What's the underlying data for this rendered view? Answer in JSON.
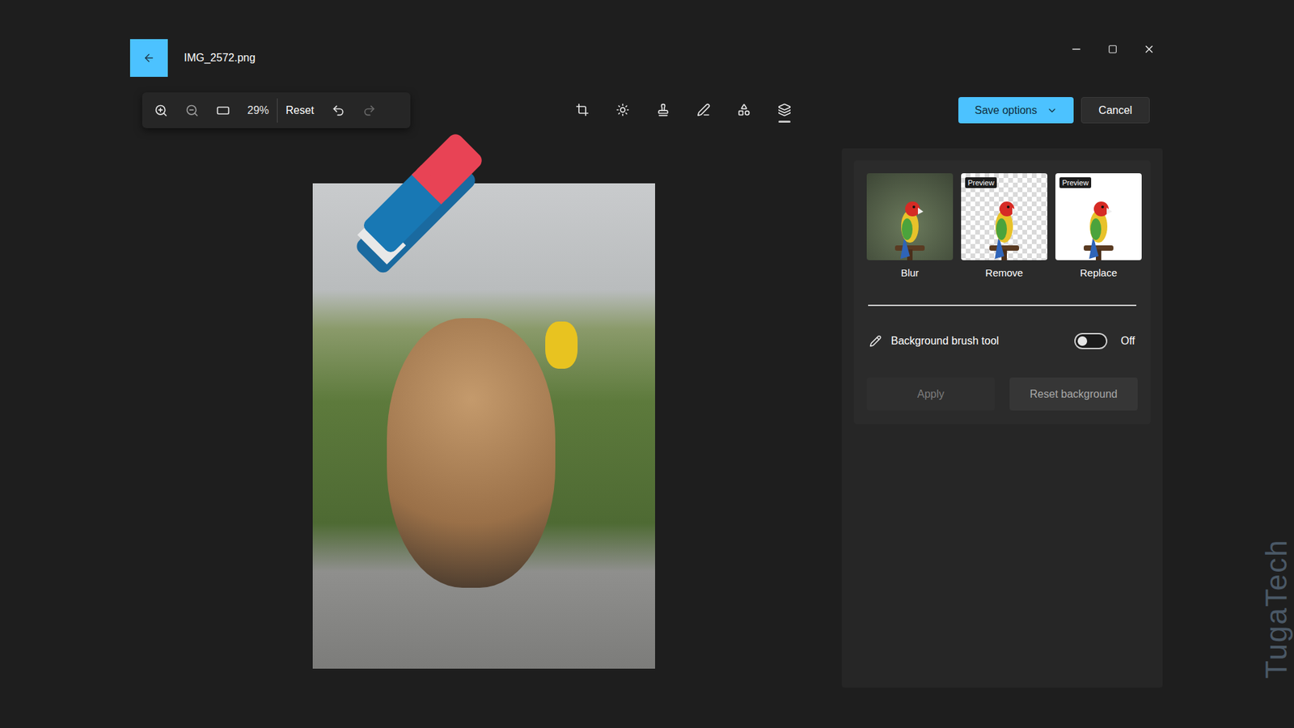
{
  "window": {
    "title": "IMG_2572.png"
  },
  "zoom_toolbar": {
    "zoom": "29%",
    "reset": "Reset",
    "undo_enabled": true,
    "redo_enabled": false
  },
  "tools": [
    {
      "selected": false
    },
    {
      "selected": false
    },
    {
      "selected": false
    },
    {
      "selected": false
    },
    {
      "selected": false
    },
    {
      "selected": true
    }
  ],
  "actions": {
    "save": "Save options",
    "cancel": "Cancel"
  },
  "background_options": [
    {
      "label": "Blur",
      "kind": "blur",
      "badge": "",
      "selected": false
    },
    {
      "label": "Remove",
      "kind": "remove",
      "badge": "Preview",
      "selected": false
    },
    {
      "label": "Replace",
      "kind": "replace",
      "badge": "Preview",
      "selected": false
    }
  ],
  "brush_tool": {
    "label": "Background brush tool",
    "on": false,
    "state": "Off"
  },
  "buttons": [
    {
      "label": "Apply",
      "disabled": true
    },
    {
      "label": "Reset background",
      "disabled": false
    }
  ],
  "watermark": "TugaTech"
}
